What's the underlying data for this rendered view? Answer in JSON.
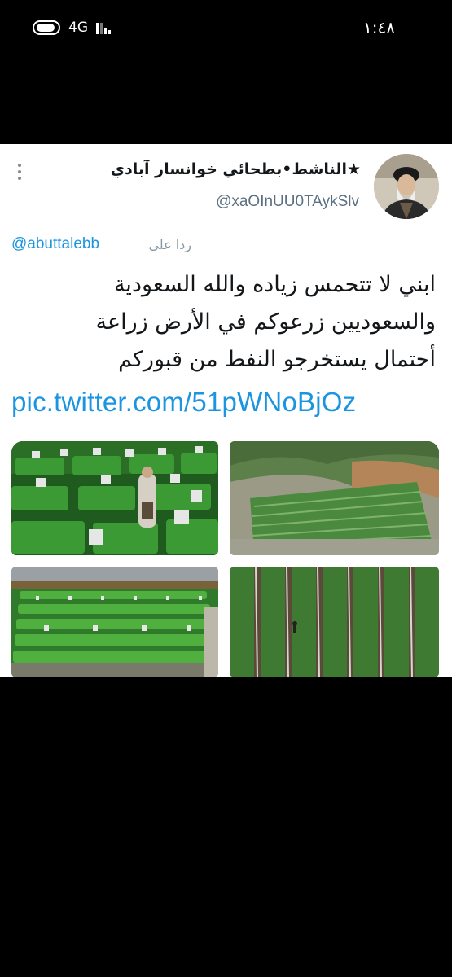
{
  "status_bar": {
    "network": "4G",
    "time": "١:٤٨"
  },
  "tweet": {
    "display_name": "★الناشط•بطحائي خوانسار آبادي",
    "handle": "@xaOInUU0TAykSlv",
    "reply_prefix": "ردا على",
    "reply_handle": "@abuttalebb",
    "text_lines": [
      "ابني لا تتحمس زياده والله السعودية",
      "والسعوديين زرعوكم في الأرض زراعة",
      "أحتمال يستخرجو النفط من قبوركم"
    ],
    "link": "pic.twitter.com/51pWNoBjOz"
  },
  "icons": {
    "more": "more-vertical-icon",
    "rotation_lock": "toggle-icon",
    "signal": "signal-icon"
  },
  "colors": {
    "background": "#000000",
    "card": "#ffffff",
    "link": "#1b95e0",
    "secondary_text": "#5b7083",
    "grave_green": "#2f8a2a"
  }
}
